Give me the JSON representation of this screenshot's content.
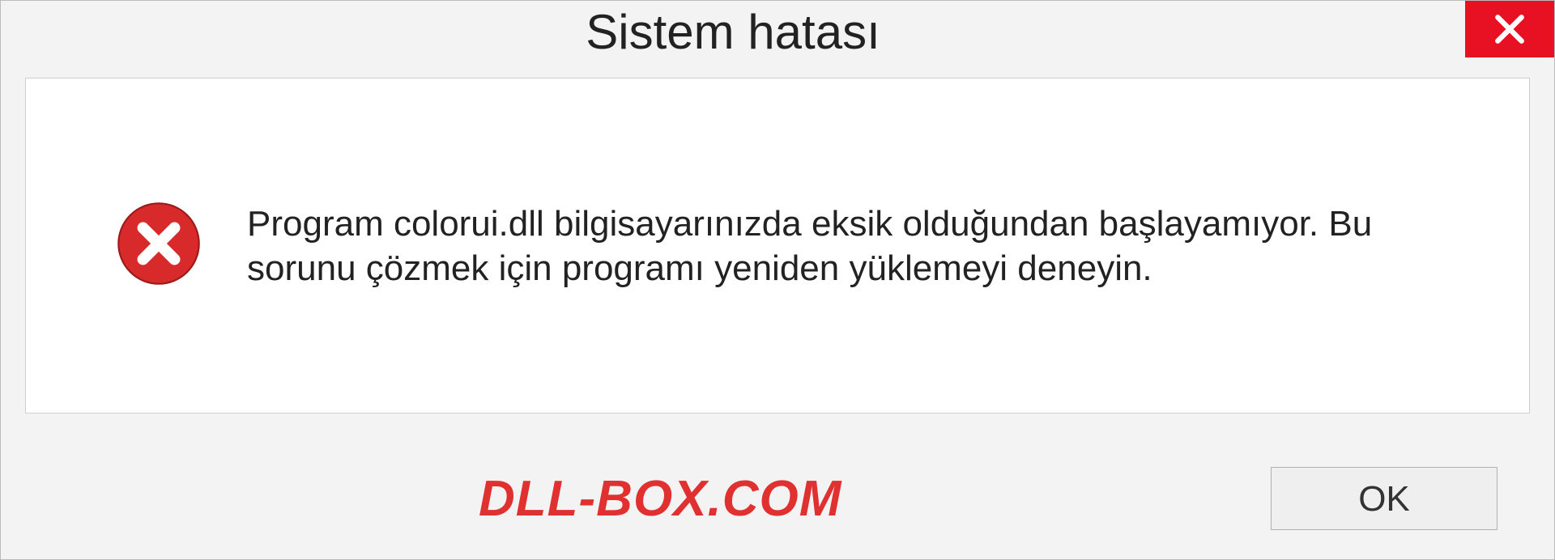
{
  "dialog": {
    "title": "Sistem hatası",
    "message": "Program colorui.dll bilgisayarınızda eksik olduğundan başlayamıyor. Bu sorunu çözmek için programı yeniden yüklemeyi deneyin.",
    "ok_label": "OK"
  },
  "watermark": "DLL-BOX.COM",
  "colors": {
    "close_bg": "#e81123",
    "error_icon": "#d82a2a",
    "watermark": "#e03030"
  }
}
